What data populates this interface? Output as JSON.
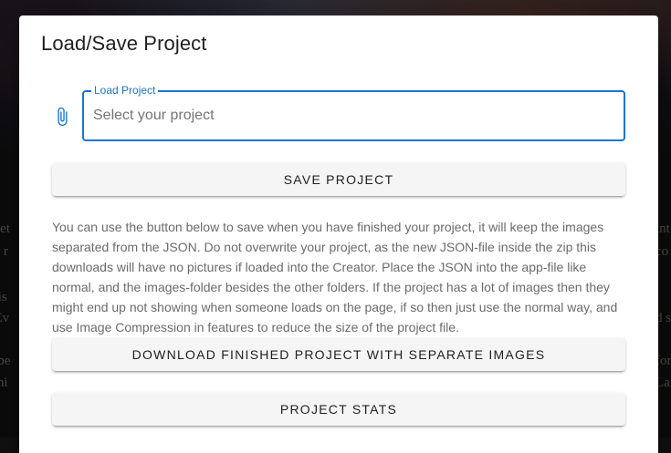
{
  "background": {
    "left_fragments": [
      "anet",
      "ke r",
      "mis",
      ". Ev",
      "o be",
      "whi"
    ],
    "right_fragments": [
      "int",
      "co",
      "",
      "d s",
      "for",
      "Lar"
    ]
  },
  "dialog": {
    "title": "Load/Save Project",
    "load_field": {
      "label": "Load Project",
      "placeholder": "Select your project",
      "value": "",
      "icon": "paperclip-icon"
    },
    "save_button": "SAVE PROJECT",
    "info_text": "You can use the button below to save when you have finished your project, it will keep the images separated from the JSON. Do not overwrite your project, as the new JSON-file inside the zip this downloads will have no pictures if loaded into the Creator. Place the JSON into the app-file like normal, and the images-folder besides the other folders. If the project has a lot of images then they might end up not showing when someone loads on the page, if so then just use the normal way, and use Image Compression in features to reduce the size of the project file.",
    "download_button": "DOWNLOAD FINISHED PROJECT WITH SEPARATE IMAGES",
    "stats_button": "PROJECT STATS"
  },
  "colors": {
    "accent": "#1976d2",
    "button_bg": "#f5f5f5",
    "dialog_bg": "#ffffff"
  }
}
